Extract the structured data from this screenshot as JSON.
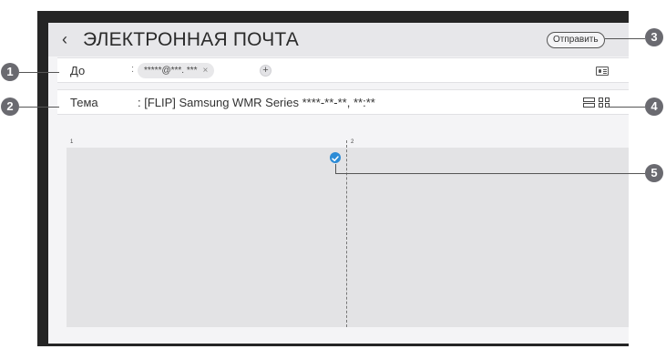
{
  "header": {
    "title": "ЭЛЕКТРОННАЯ ПОЧТА",
    "send_label": "Отправить"
  },
  "to_row": {
    "label": "До",
    "separator": ":",
    "recipient": "*****@***. ***",
    "remove_glyph": "×",
    "add_glyph": "+"
  },
  "subject_row": {
    "label": "Тема",
    "value": ": [FLIP] Samsung WMR Series ****-**-**, **:**"
  },
  "pages": {
    "page1": "1",
    "page2": "2"
  },
  "callouts": [
    "1",
    "2",
    "3",
    "4",
    "5"
  ],
  "icons": {
    "back": "chevron-left-icon",
    "contacts": "contact-card-icon",
    "layout_list": "layout-list-icon",
    "layout_grid": "layout-grid-icon",
    "selected": "check-circle-icon"
  },
  "colors": {
    "selection_accent": "#2b8bd6",
    "callout_badge": "#6a6a70",
    "screen_bezel": "#252525"
  }
}
